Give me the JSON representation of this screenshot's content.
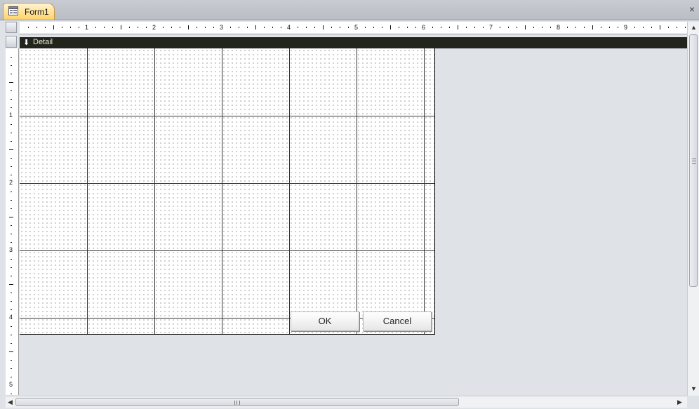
{
  "window": {
    "tab_title": "Form1",
    "close_symbol": "×"
  },
  "rulers": {
    "horizontal_numbers": [
      "1",
      "2",
      "3",
      "4",
      "5",
      "6",
      "7",
      "8",
      "9"
    ],
    "vertical_numbers": [
      "1",
      "2",
      "3",
      "4",
      "5"
    ]
  },
  "section": {
    "label": "Detail",
    "arrow_symbol": "🡇"
  },
  "buttons": {
    "ok_label": "OK",
    "cancel_label": "Cancel"
  },
  "scrollbars": {
    "up_arrow": "▲",
    "down_arrow": "▼",
    "left_arrow": "◀",
    "right_arrow": "▶"
  },
  "icons": {
    "form_icon": "form-icon",
    "detail_icon": "section-collapse-arrow-icon"
  }
}
